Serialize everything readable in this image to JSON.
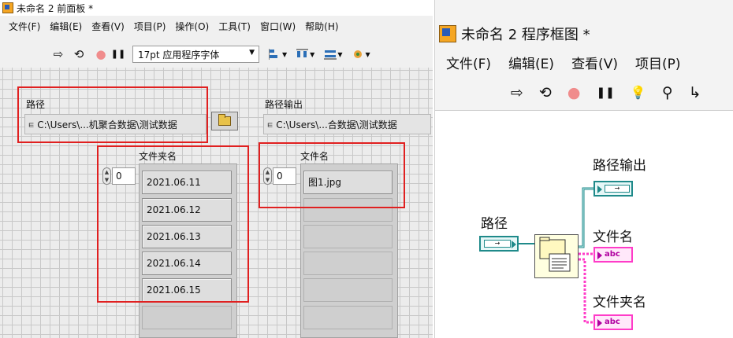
{
  "front_panel": {
    "title": "未命名 2 前面板 *",
    "menu": [
      "文件(F)",
      "编辑(E)",
      "查看(V)",
      "项目(P)",
      "操作(O)",
      "工具(T)",
      "窗口(W)",
      "帮助(H)"
    ],
    "toolbar": {
      "run_icon": "⇨",
      "run_continuous_icon": "⟲",
      "abort_icon": "●",
      "pause_icon": "❚❚",
      "font_select": "17pt 应用程序字体",
      "caret": "▼"
    },
    "controls": {
      "path": {
        "label": "路径",
        "prefix": "ㅌ",
        "value": "C:\\Users\\...机聚合数据\\测试数据"
      },
      "path_out": {
        "label": "路径输出",
        "prefix": "ㅌ",
        "value": "C:\\Users\\...合数据\\测试数据"
      },
      "folder_names": {
        "label": "文件夹名",
        "index": "0",
        "values": [
          "2021.06.11",
          "2021.06.12",
          "2021.06.13",
          "2021.06.14",
          "2021.06.15"
        ]
      },
      "file_names": {
        "label": "文件名",
        "index": "0",
        "values": [
          "图1.jpg"
        ]
      }
    }
  },
  "block_diagram": {
    "title": "未命名 2 程序框图 *",
    "menu": [
      "文件(F)",
      "编辑(E)",
      "查看(V)",
      "项目(P)"
    ],
    "toolbar": {
      "run_icon": "⇨",
      "run_continuous_icon": "⟲",
      "abort_icon": "●",
      "pause_icon": "❚❚",
      "highlight_icon": "💡",
      "retain_icon": "⚲",
      "step_icon": "↳"
    },
    "terminals": {
      "path_in": "路径",
      "path_out": "路径输出",
      "file_name": "文件名",
      "folder_name": "文件夹名",
      "string_glyph": "abc",
      "path_glyph": "→"
    },
    "colors": {
      "path_wire": "#1f8a8a",
      "string_wire": "#ff3cc8"
    }
  }
}
